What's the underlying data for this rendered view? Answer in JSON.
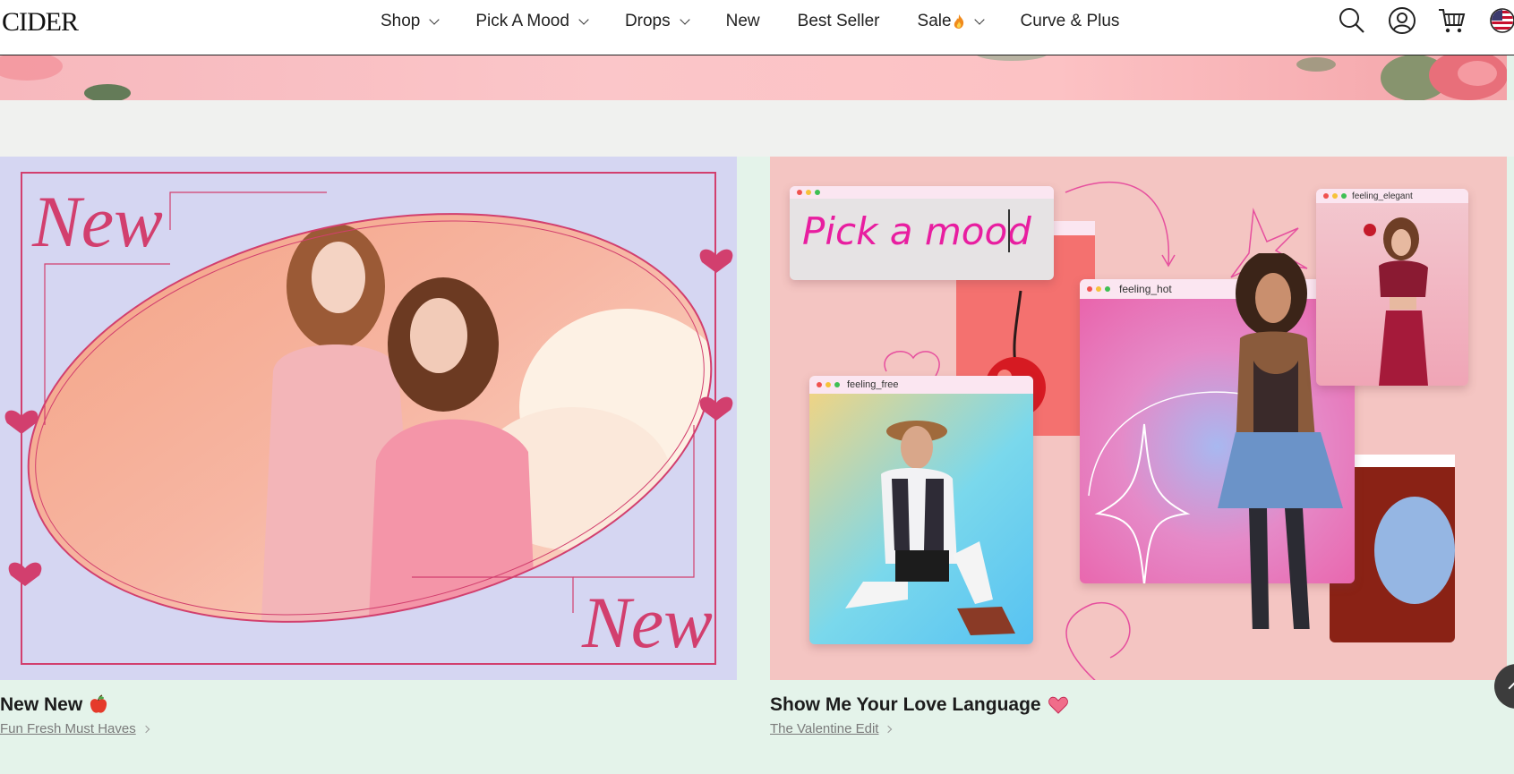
{
  "header": {
    "logo": "CIDER",
    "nav": [
      {
        "label": "Shop",
        "has_dropdown": true
      },
      {
        "label": "Pick A Mood",
        "has_dropdown": true
      },
      {
        "label": "Drops",
        "has_dropdown": true
      },
      {
        "label": "New",
        "has_dropdown": false
      },
      {
        "label": "Best Seller",
        "has_dropdown": false
      },
      {
        "label": "Sale",
        "has_dropdown": true,
        "icon": "fire-icon"
      },
      {
        "label": "Curve & Plus",
        "has_dropdown": false
      }
    ],
    "icons": [
      "search-icon",
      "account-icon",
      "cart-icon",
      "us-flag-icon"
    ]
  },
  "cards": [
    {
      "image_text_top": "New",
      "image_text_bottom": "New",
      "title": "New New",
      "title_icon": "apple-icon",
      "subtitle": "Fun Fresh Must Haves"
    },
    {
      "image_heading": "Pick a mood",
      "windows": [
        "feeling_free",
        "feeling_hot",
        "feeling_elegant"
      ],
      "title": "Show Me Your Love Language",
      "title_icon": "heart-icon",
      "subtitle": "The Valentine Edit"
    }
  ],
  "colors": {
    "accent_pink": "#e81ea0",
    "frame_pink": "#d23f6e",
    "left_card_bg": "#d5d6f2",
    "right_card_bg": "#f4c5c2",
    "page_bg": "#e4f3ea"
  }
}
